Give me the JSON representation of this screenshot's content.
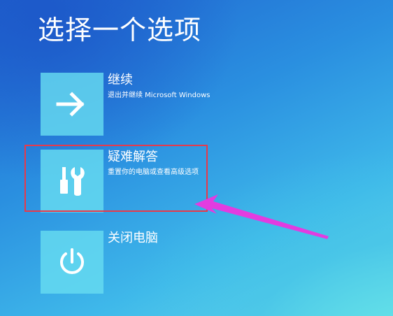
{
  "page": {
    "title": "选择一个选项"
  },
  "options": [
    {
      "title": "继续",
      "description": "退出并继续 Microsoft Windows",
      "icon": "arrow-right-icon"
    },
    {
      "title": "疑难解答",
      "description": "重置你的电脑或查看高级选项",
      "icon": "tools-icon"
    },
    {
      "title": "关闭电脑",
      "description": "",
      "icon": "power-icon"
    }
  ],
  "colors": {
    "background_top": "#1f63cf",
    "background_bottom": "#6ad9ec",
    "tile": "#66dcf0",
    "highlight_box": "#e8394a",
    "annotation_arrow": "#e23ce0"
  }
}
